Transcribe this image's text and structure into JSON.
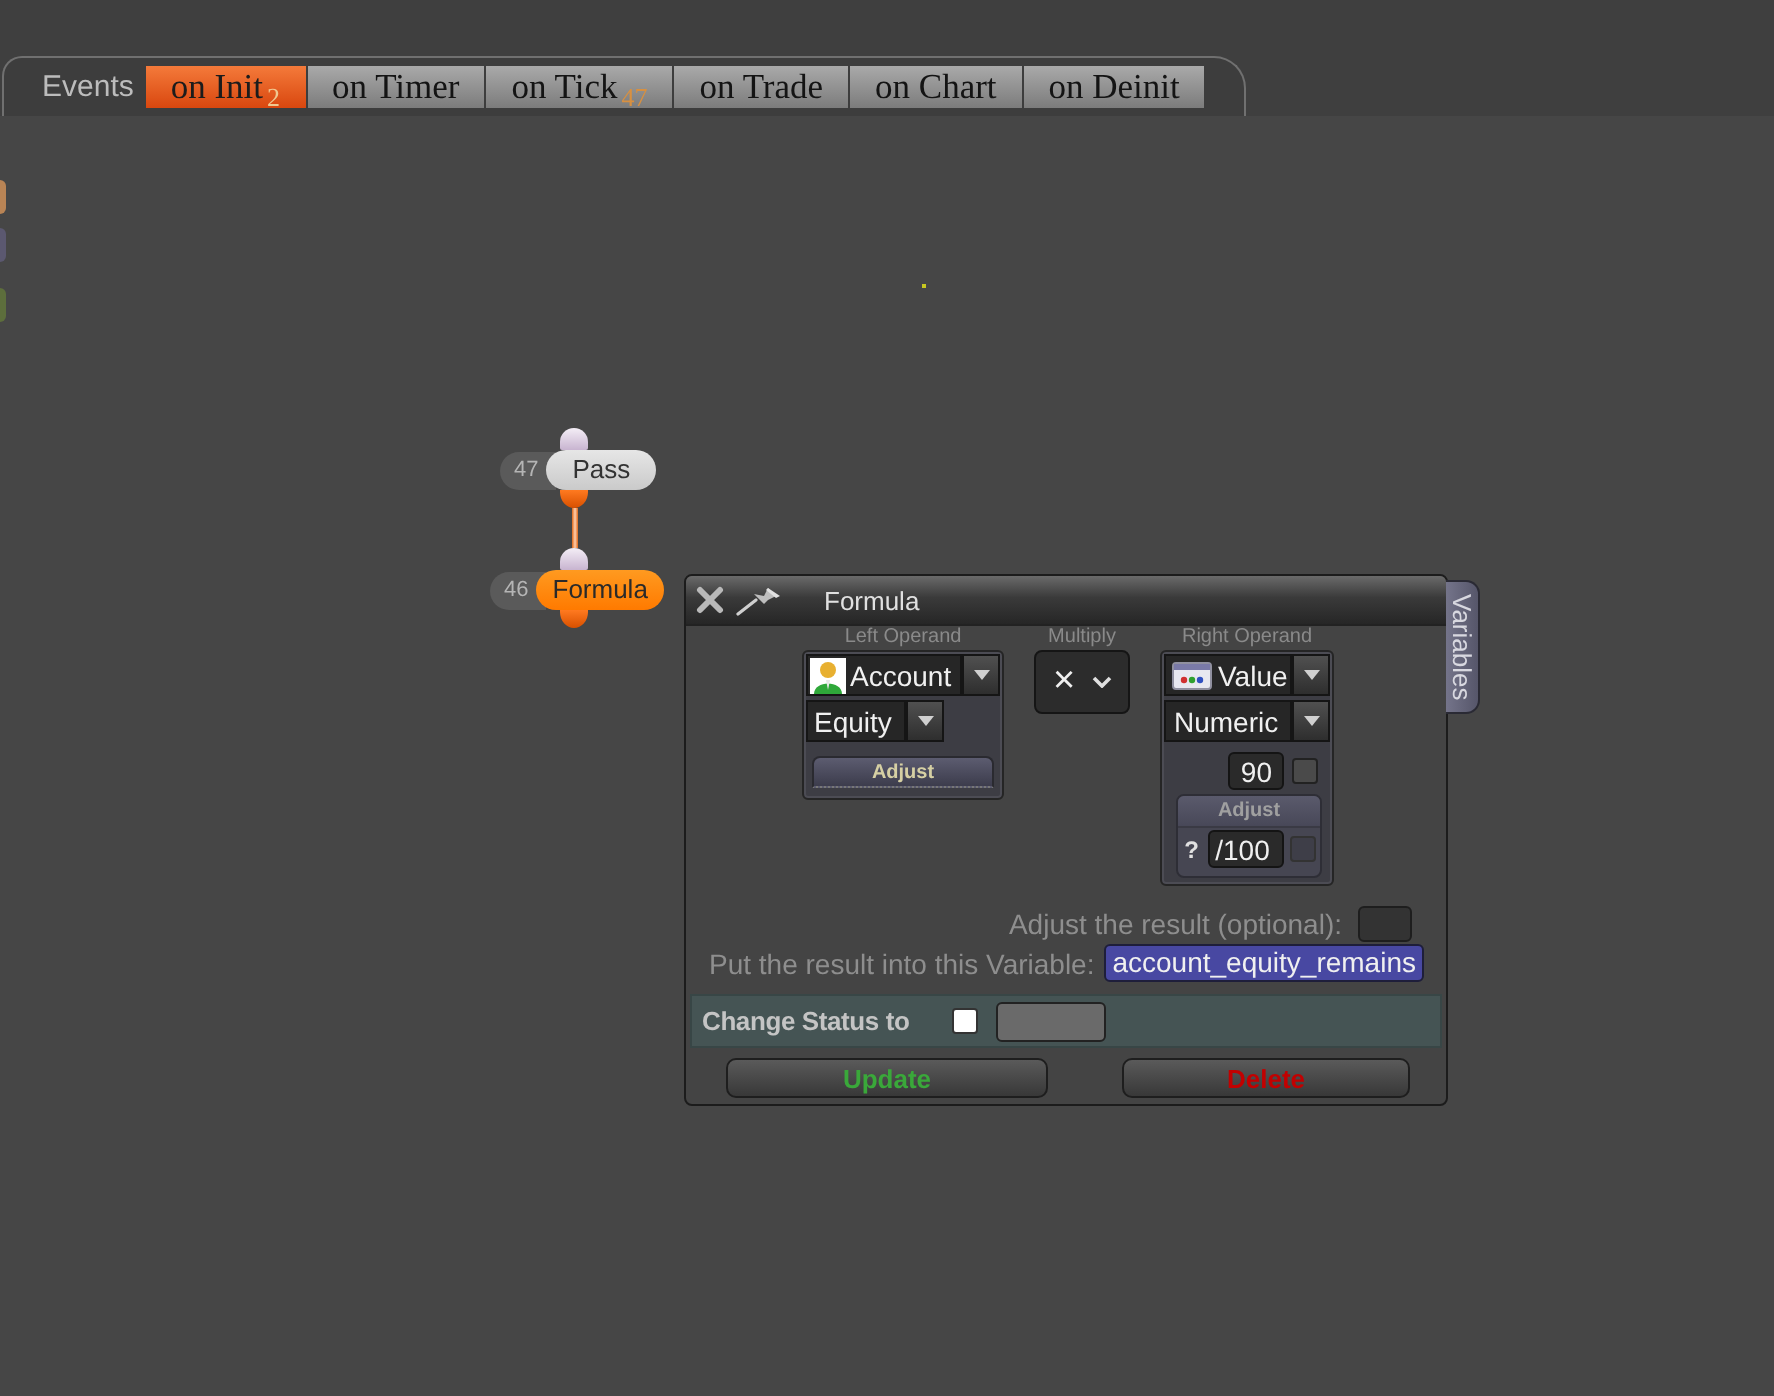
{
  "tab_bar": {
    "label": "Events",
    "tabs": [
      {
        "label": "on Init",
        "badge": "2",
        "selected": true
      },
      {
        "label": "on Timer",
        "selected": false
      },
      {
        "label": "on Tick",
        "badge": "47",
        "selected": false
      },
      {
        "label": "on Trade",
        "selected": false
      },
      {
        "label": "on Chart",
        "selected": false
      },
      {
        "label": "on Deinit",
        "selected": false
      }
    ]
  },
  "edge_nodes": [
    {
      "color": "#b98455"
    },
    {
      "color": "#5b5870"
    },
    {
      "color": "#5d6e3c"
    }
  ],
  "nodes": [
    {
      "number": "47",
      "label": "Pass",
      "selected": false
    },
    {
      "number": "46",
      "label": "Formula",
      "selected": true
    }
  ],
  "dialog": {
    "title": "Formula",
    "side_tab": "Variables",
    "left_operand": {
      "heading": "Left Operand",
      "source": "Account",
      "property": "Equity",
      "adjust_button": "Adjust"
    },
    "operator": {
      "heading": "Multiply",
      "symbol": "×"
    },
    "right_operand": {
      "heading": "Right Operand",
      "source": "Value",
      "type": "Numeric",
      "value": "90",
      "value_checked": false,
      "adjust_heading": "Adjust",
      "adjust_help": "?",
      "adjust_value": "/100",
      "adjust_checked": false
    },
    "result_adjust": {
      "label": "Adjust the result (optional):"
    },
    "result_variable": {
      "label": "Put the result into this Variable:",
      "value": "account_equity_remains"
    },
    "change_status": {
      "label": "Change Status to",
      "checked": false
    },
    "buttons": [
      {
        "label": "Update",
        "kind": "update"
      },
      {
        "label": "Delete",
        "kind": "delete"
      }
    ]
  }
}
